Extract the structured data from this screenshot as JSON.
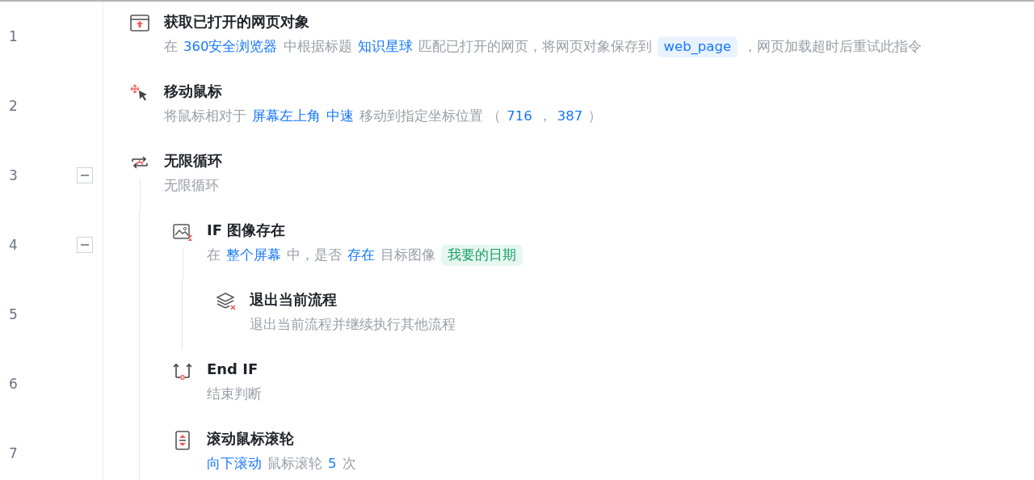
{
  "steps": [
    {
      "line": "1",
      "title": "获取已打开的网页对象",
      "description": [
        {
          "kind": "text",
          "text": "在"
        },
        {
          "kind": "param",
          "text": "360安全浏览器"
        },
        {
          "kind": "text",
          "text": "中根据标题"
        },
        {
          "kind": "param",
          "text": "知识星球"
        },
        {
          "kind": "text",
          "text": "匹配已打开的网页，将网页对象保存到"
        },
        {
          "kind": "variable",
          "text": "web_page"
        },
        {
          "kind": "text",
          "text": "，网页加载超时后重试此指令"
        }
      ]
    },
    {
      "line": "2",
      "title": "移动鼠标",
      "description": [
        {
          "kind": "text",
          "text": "将鼠标相对于"
        },
        {
          "kind": "param",
          "text": "屏幕左上角"
        },
        {
          "kind": "param",
          "text": "中速"
        },
        {
          "kind": "text",
          "text": "移动到指定坐标位置 （"
        },
        {
          "kind": "param",
          "text": "716"
        },
        {
          "kind": "text",
          "text": "，"
        },
        {
          "kind": "param",
          "text": "387"
        },
        {
          "kind": "text",
          "text": "）"
        }
      ]
    },
    {
      "line": "3",
      "title": "无限循环",
      "expanded": true,
      "description": [
        {
          "kind": "text",
          "text": "无限循环"
        }
      ],
      "children": [
        {
          "line": "4",
          "title": "IF 图像存在",
          "expanded": true,
          "description": [
            {
              "kind": "text",
              "text": "在"
            },
            {
              "kind": "param",
              "text": "整个屏幕"
            },
            {
              "kind": "text",
              "text": "中，是否"
            },
            {
              "kind": "param",
              "text": "存在"
            },
            {
              "kind": "text",
              "text": "目标图像"
            },
            {
              "kind": "image",
              "text": "我要的日期"
            }
          ],
          "children": [
            {
              "line": "5",
              "title": "退出当前流程",
              "description": [
                {
                  "kind": "text",
                  "text": "退出当前流程并继续执行其他流程"
                }
              ]
            }
          ]
        },
        {
          "line": "6",
          "title": "End IF",
          "description": [
            {
              "kind": "text",
              "text": "结束判断"
            }
          ]
        },
        {
          "line": "7",
          "title": "滚动鼠标滚轮",
          "description": [
            {
              "kind": "param",
              "text": "向下滚动"
            },
            {
              "kind": "text",
              "text": "鼠标滚轮"
            },
            {
              "kind": "param",
              "text": "5"
            },
            {
              "kind": "text",
              "text": "次"
            }
          ]
        }
      ]
    }
  ]
}
